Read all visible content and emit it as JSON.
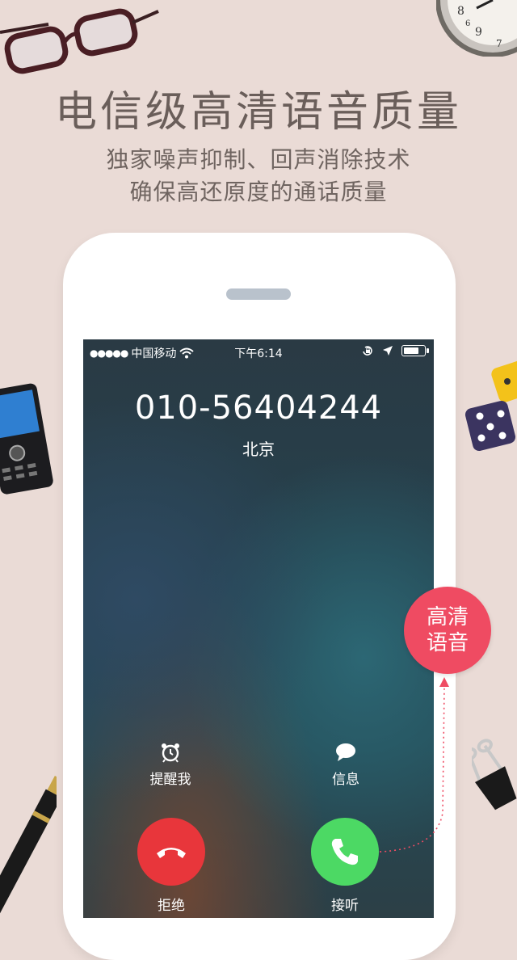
{
  "headline": "电信级高清语音质量",
  "sub_line1": "独家噪声抑制、回声消除技术",
  "sub_line2": "确保高还原度的通话质量",
  "status_bar": {
    "signal": "●●●●●",
    "carrier": "中国移动",
    "time": "下午6:14",
    "battery_level": 0.8
  },
  "call": {
    "number": "010-56404244",
    "location": "北京"
  },
  "options": {
    "remind_label": "提醒我",
    "message_label": "信息"
  },
  "buttons": {
    "decline_label": "拒绝",
    "accept_label": "接听"
  },
  "badge": {
    "line1": "高清",
    "line2": "语音"
  },
  "colors": {
    "background": "#eadbd6",
    "badge": "#ef4b62",
    "decline": "#e8363b",
    "accept": "#4cd964",
    "headline": "#6a5e5a"
  }
}
